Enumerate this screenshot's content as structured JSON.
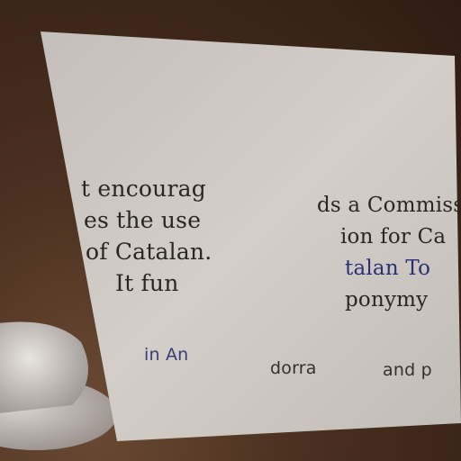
{
  "colors": {
    "paper": "#cfcac4",
    "background": "#4a3020",
    "text": "#2a2622",
    "blue_text": "#2b2f7a"
  },
  "left_column": [
    "t encourag",
    "es the use",
    "of Catalan.",
    "It fun"
  ],
  "right_column": [
    "ds a Commiss",
    "ion for Ca",
    "talan To",
    "ponymy"
  ],
  "bottom_row": [
    "in An",
    "dorra",
    "and p"
  ]
}
